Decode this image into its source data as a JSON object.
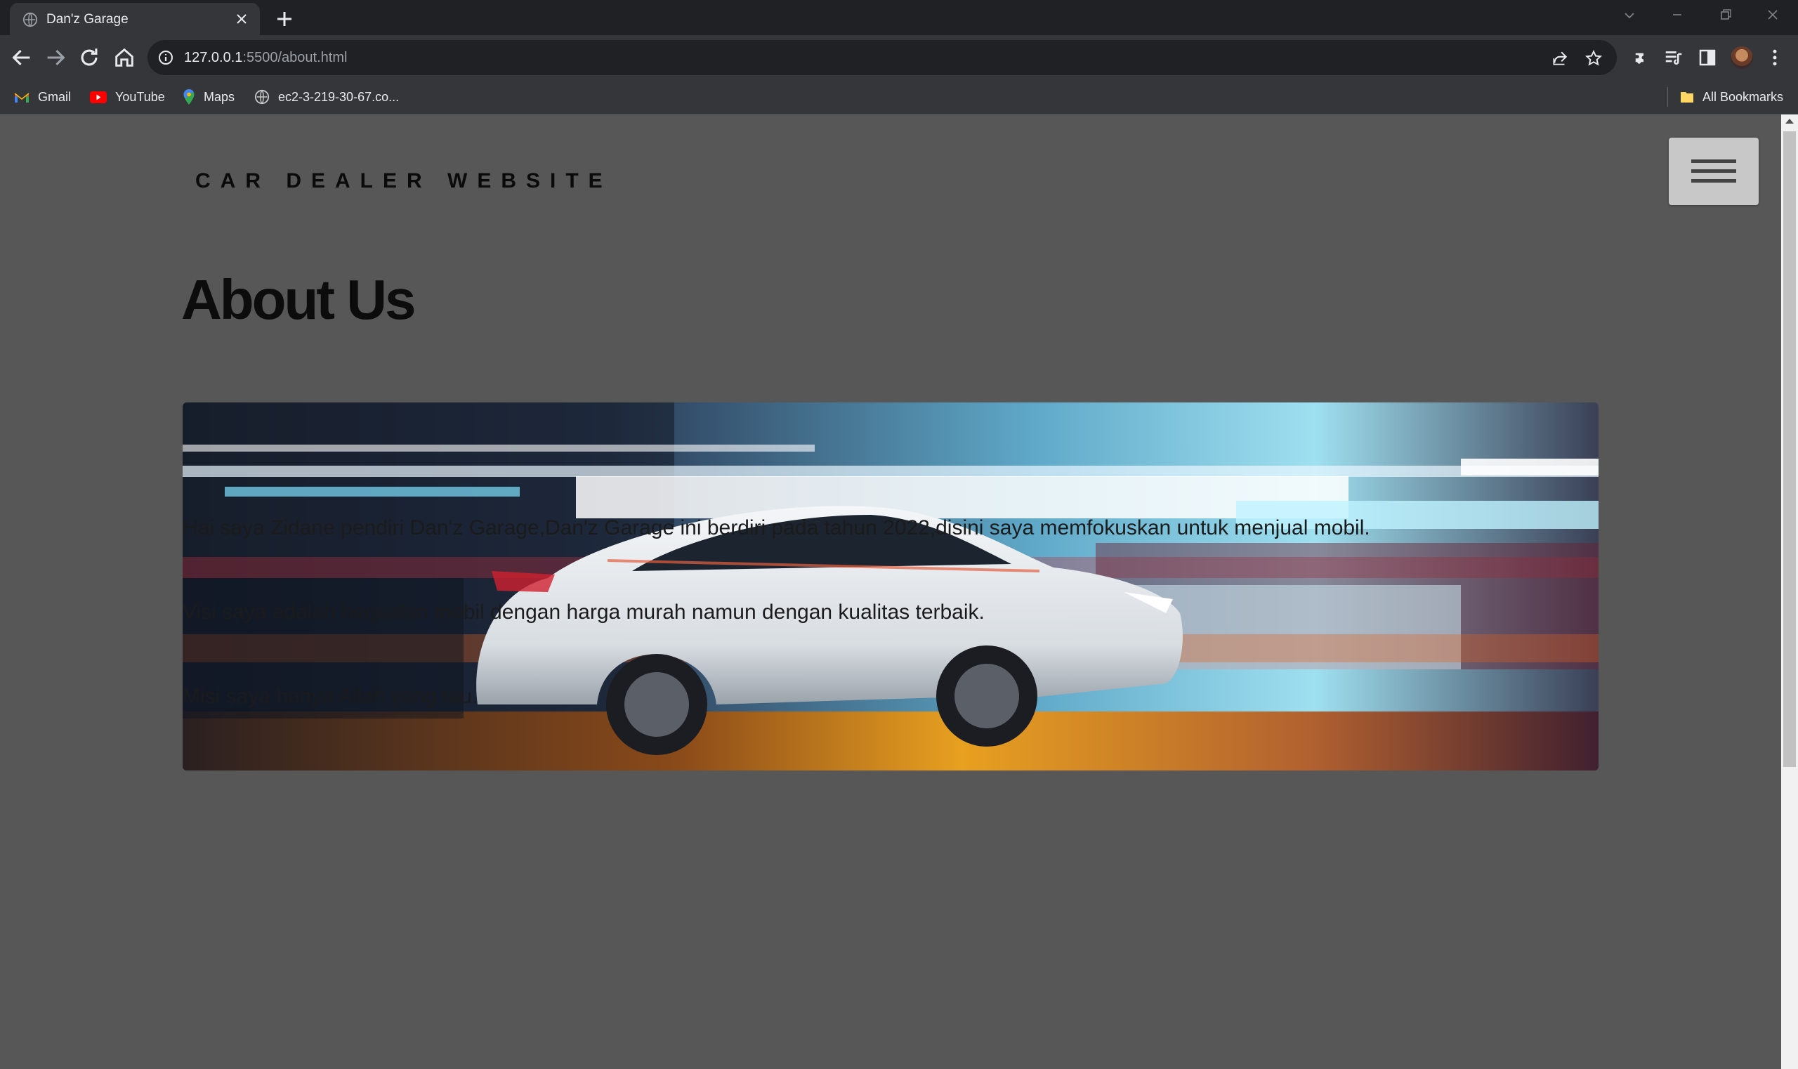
{
  "browser": {
    "tab_title": "Dan'z Garage",
    "url_host": "127.0.0.1",
    "url_path": ":5500/about.html",
    "bookmarks": [
      {
        "label": "Gmail",
        "icon": "gmail-icon"
      },
      {
        "label": "YouTube",
        "icon": "youtube-icon"
      },
      {
        "label": "Maps",
        "icon": "maps-icon"
      },
      {
        "label": "ec2-3-219-30-67.co...",
        "icon": "globe-icon"
      }
    ],
    "all_bookmarks": "All Bookmarks"
  },
  "page": {
    "brand": "CAR DEALER WEBSITE",
    "heading": "About Us",
    "hero_alt": "white sedan motion blur at night",
    "paragraphs": [
      "Hai saya Zidane pendiri Dan'z Garage,Dan'z Garage ini berdiri pada tahun 2022,disini saya memfokuskan untuk menjual mobil.",
      "Visi saya adalah berjualan mobil dengan harga murah namun dengan kualitas terbaik.",
      "Misi saya hanya Allah yang tau."
    ]
  },
  "colors": {
    "page_bg": "#575757",
    "browser_dark": "#202124",
    "browser_toolbar": "#35363a",
    "text_dark": "#0c0c0c"
  }
}
